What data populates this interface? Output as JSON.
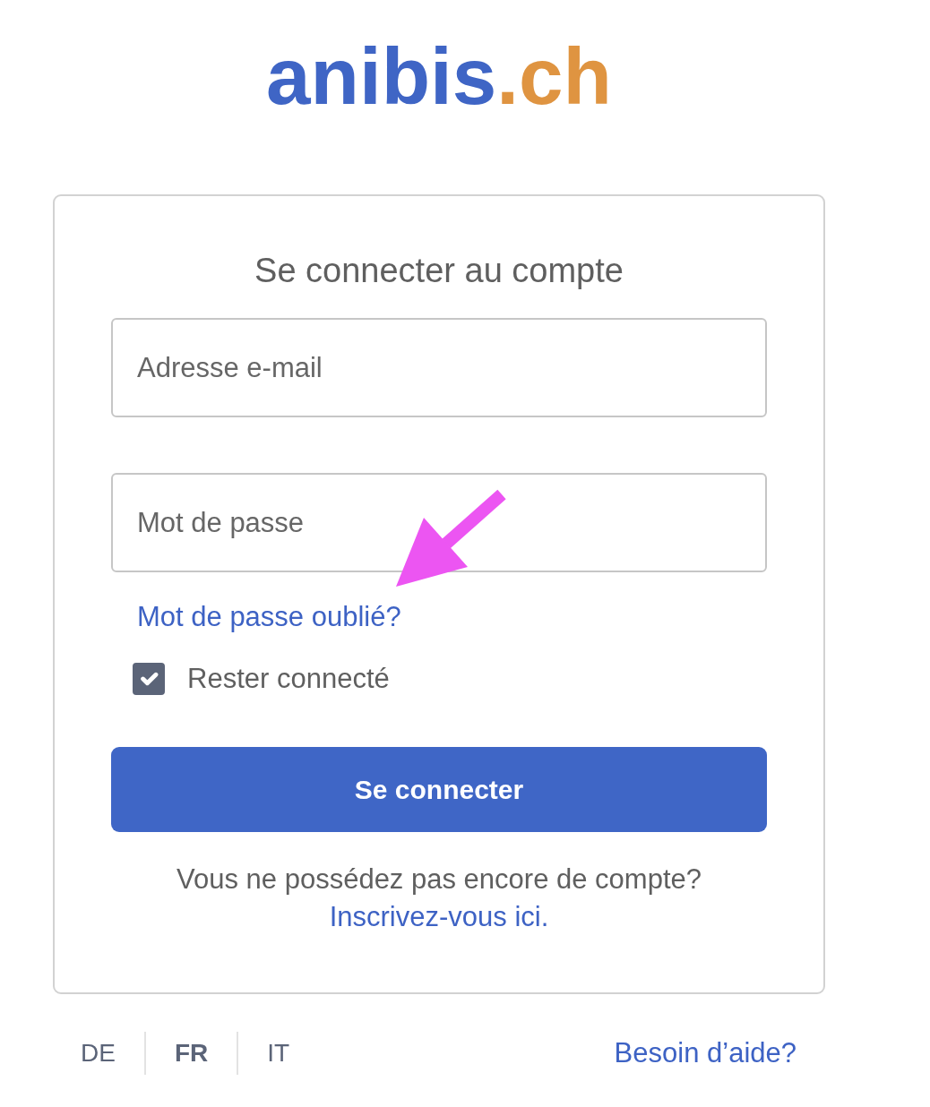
{
  "logo": {
    "text": "anibis",
    "suffix": ".ch"
  },
  "login_card": {
    "title": "Se connecter au compte",
    "fields": [
      {
        "placeholder": "Adresse e-mail"
      },
      {
        "placeholder": "Mot de passe"
      }
    ],
    "forgot_link": "Mot de passe oublié?",
    "remember": {
      "label": "Rester connecté",
      "checked": true
    },
    "submit_button": "Se connecter",
    "signup_prompt": "Vous ne possédez pas encore de compte?",
    "signup_link": "Inscrivez-vous ici."
  },
  "footer": {
    "languages": [
      {
        "label": "DE",
        "selected": false
      },
      {
        "label": "FR",
        "selected": true
      },
      {
        "label": "IT",
        "selected": false
      }
    ],
    "help_link": "Besoin d’aide?"
  }
}
